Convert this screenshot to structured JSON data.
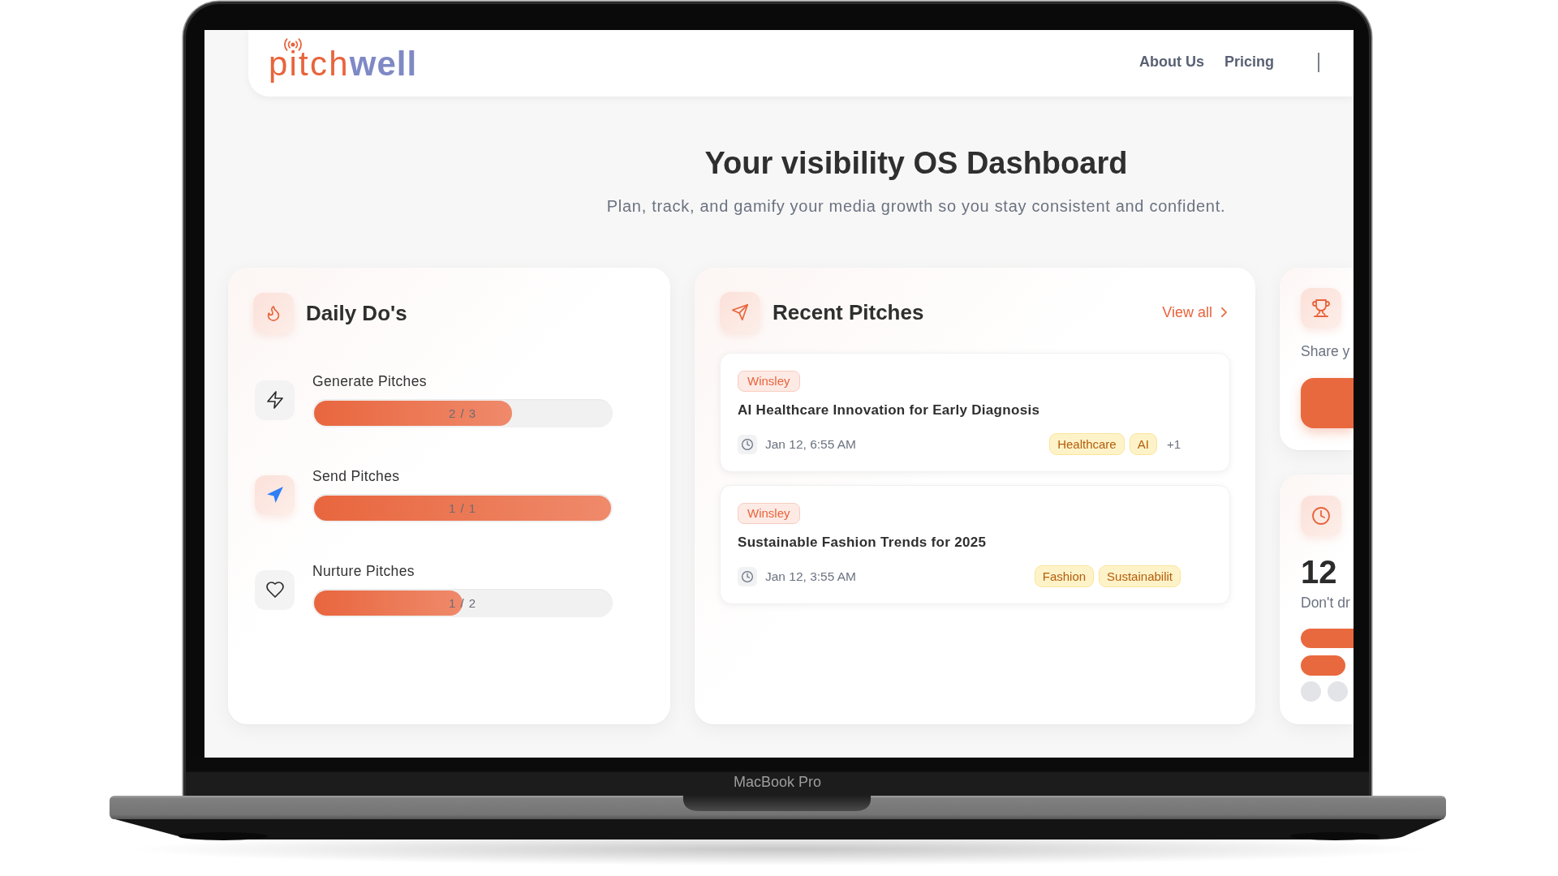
{
  "header": {
    "logo": "pitch**well**",
    "nav": [
      "About Us",
      "Pricing"
    ]
  },
  "hero": {
    "title": "Your visibility OS Dashboard",
    "subtitle": "Plan, track, and gamify your media growth so you stay consistent and confident."
  },
  "daily_dos": {
    "title": "Daily Do's",
    "items": [
      {
        "label": "Generate Pitches",
        "progress": "2 / 3",
        "level": 0.667,
        "completed": false
      },
      {
        "label": "Send Pitches",
        "progress": "1 / 1",
        "level": 1,
        "completed": true
      },
      {
        "label": "Nurture Pitches",
        "progress": "1 / 2",
        "level": 0.5,
        "completed": false
      }
    ]
  },
  "recent_pitches": {
    "title": "Recent Pitches",
    "link": "View all",
    "pitches": [
      {
        "source": "Winsley",
        "title": "AI Healthcare Innovation for Early Diagnosis",
        "time": "Jan 12, 6:55 AM",
        "tags": [
          "Healthcare",
          "AI"
        ],
        "more": "+1"
      },
      {
        "source": "Winsley",
        "title": "Sustainable Fashion Trends for 2025",
        "time": "Jan 12, 3:55 AM",
        "tags": [
          "Fashion",
          "Sustainabilit"
        ]
      }
    ]
  },
  "share_card": {
    "text": "Share y"
  },
  "days_card": {
    "value": "12",
    "text": "Don't dr"
  },
  "laptop": {
    "label": "MacBook Pro"
  }
}
